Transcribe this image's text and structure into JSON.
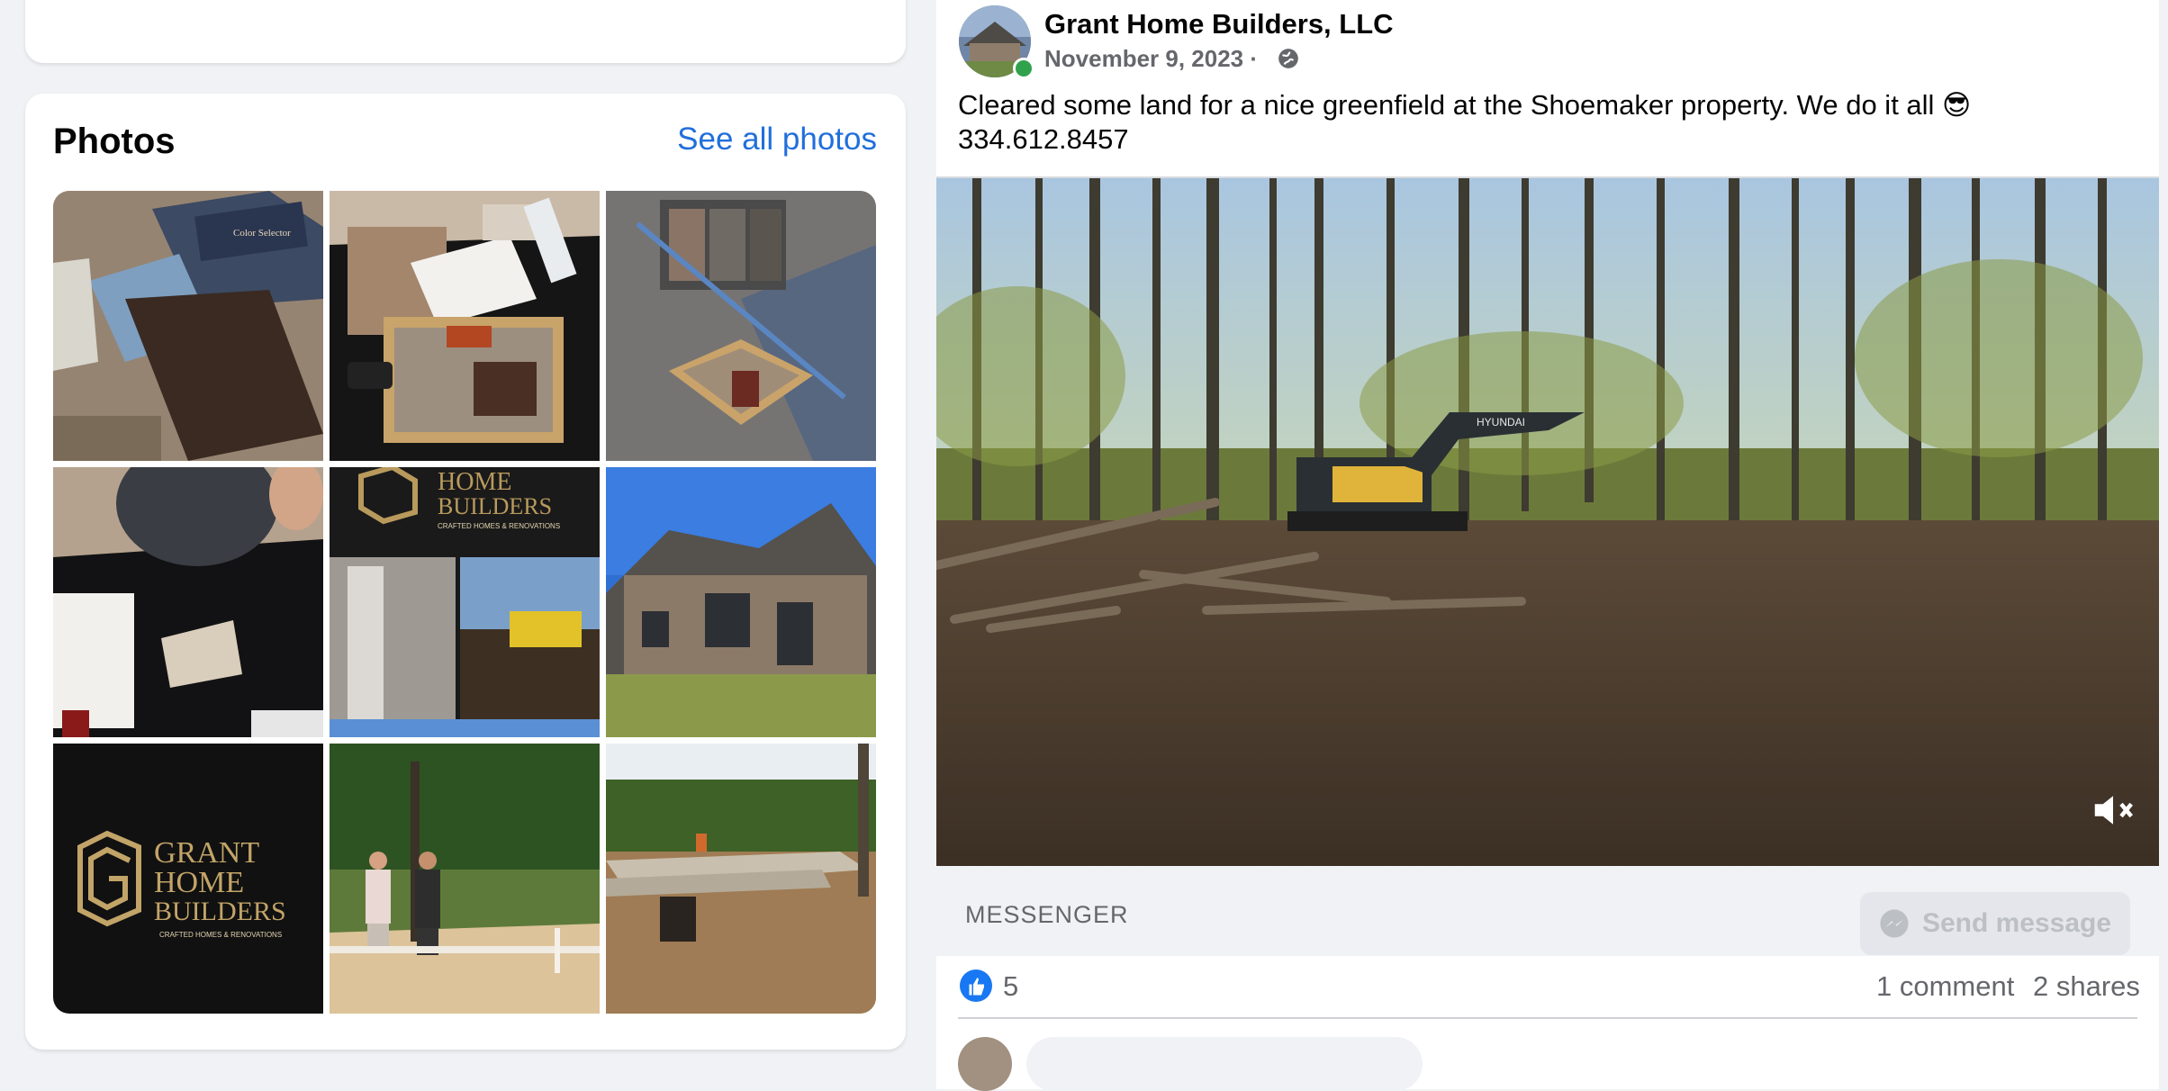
{
  "photos": {
    "title": "Photos",
    "see_all": "See all photos",
    "tiles": [
      {
        "label": "Color Selector"
      },
      {
        "label": ""
      },
      {
        "label": ""
      },
      {
        "label": ""
      },
      {
        "logo_line1": "HOME",
        "logo_line2": "BUILDERS",
        "logo_tagline": "CRAFTED HOMES & RENOVATIONS"
      },
      {
        "label": ""
      },
      {
        "logo_line1": "GRANT",
        "logo_line2": "HOME",
        "logo_line3": "BUILDERS",
        "logo_tagline": "CRAFTED HOMES & RENOVATIONS"
      },
      {
        "label": ""
      },
      {
        "label": ""
      }
    ]
  },
  "post": {
    "page_name": "Grant Home Builders, LLC",
    "date": "November 9, 2023 ·",
    "text_line1": "Cleared some land for a nice greenfield at the Shoemaker property. We do it all 😎",
    "text_line2": "334.612.8457",
    "video_brand": "HYUNDAI",
    "messenger_label": "MESSENGER",
    "send_message": "Send message",
    "like_count": "5",
    "comment_count": "1 comment",
    "share_count": "2 shares"
  },
  "colors": {
    "link_blue": "#216fdb",
    "facebook_blue": "#1877f2",
    "online_green": "#31a24c",
    "background": "#f0f2f5"
  }
}
